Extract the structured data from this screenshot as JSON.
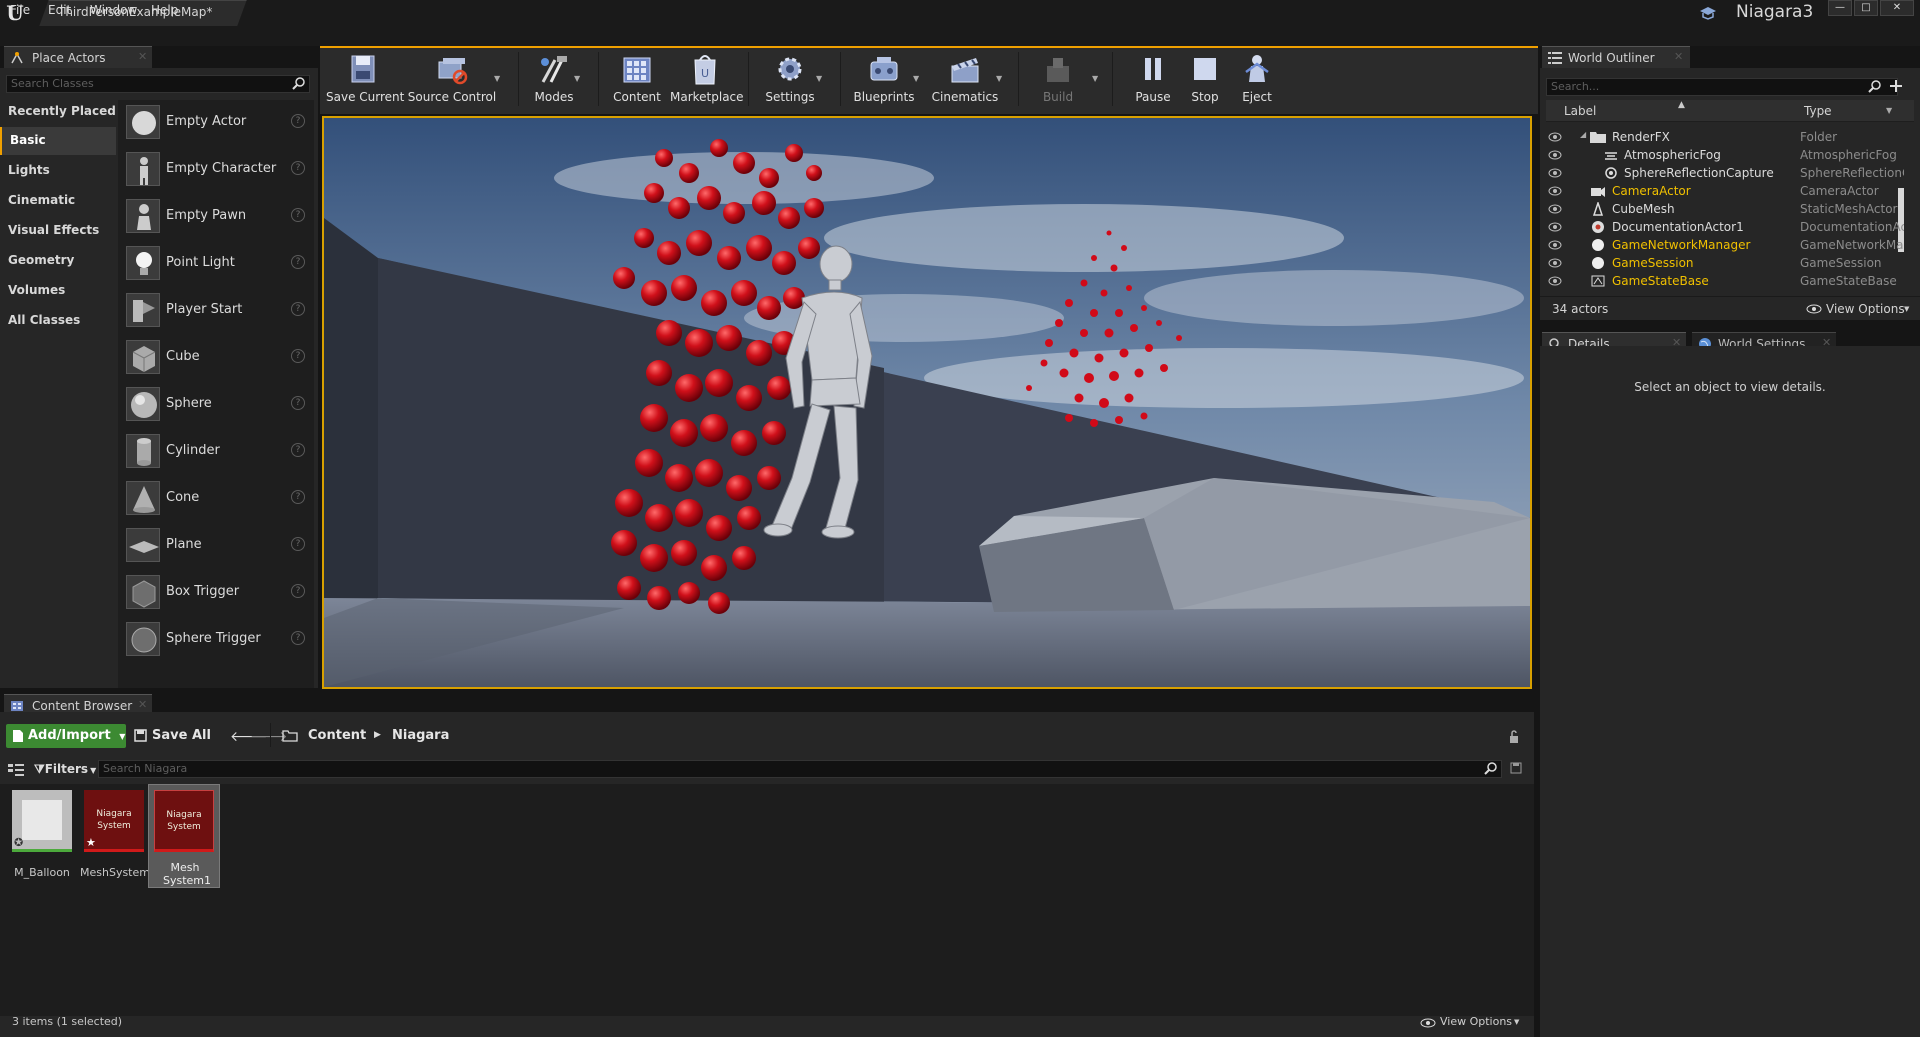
{
  "window": {
    "doc_tab": "ThirdPersonExampleMap*",
    "project_name": "Niagara3",
    "buttons": {
      "minimize": "—",
      "maximize": "□",
      "close": "✕"
    }
  },
  "menu": [
    "File",
    "Edit",
    "Window",
    "Help"
  ],
  "place_actors": {
    "tab": "Place Actors",
    "search_placeholder": "Search Classes",
    "categories": [
      "Recently Placed",
      "Basic",
      "Lights",
      "Cinematic",
      "Visual Effects",
      "Geometry",
      "Volumes",
      "All Classes"
    ],
    "selected_category": "Basic",
    "items": [
      "Empty Actor",
      "Empty Character",
      "Empty Pawn",
      "Point Light",
      "Player Start",
      "Cube",
      "Sphere",
      "Cylinder",
      "Cone",
      "Plane",
      "Box Trigger",
      "Sphere Trigger"
    ],
    "help_glyph": "?"
  },
  "toolbar": {
    "save_current": "Save Current",
    "source_control": "Source Control",
    "modes": "Modes",
    "content": "Content",
    "marketplace": "Marketplace",
    "settings": "Settings",
    "blueprints": "Blueprints",
    "cinematics": "Cinematics",
    "build": "Build",
    "pause": "Pause",
    "stop": "Stop",
    "eject": "Eject"
  },
  "world_outliner": {
    "tab": "World Outliner",
    "search_placeholder": "Search...",
    "col_label": "Label",
    "col_type": "Type",
    "rows": [
      {
        "label": "RenderFX",
        "type": "Folder",
        "indent": 0,
        "highlight": false
      },
      {
        "label": "AtmosphericFog",
        "type": "AtmosphericFog",
        "indent": 1,
        "highlight": false
      },
      {
        "label": "SphereReflectionCapture",
        "type": "SphereReflectionC",
        "indent": 1,
        "highlight": false
      },
      {
        "label": "CameraActor",
        "type": "CameraActor",
        "indent": 0,
        "highlight": true
      },
      {
        "label": "CubeMesh",
        "type": "StaticMeshActor",
        "indent": 0,
        "highlight": false
      },
      {
        "label": "DocumentationActor1",
        "type": "DocumentationAc",
        "indent": 0,
        "highlight": false
      },
      {
        "label": "GameNetworkManager",
        "type": "GameNetworkMar",
        "indent": 0,
        "highlight": true
      },
      {
        "label": "GameSession",
        "type": "GameSession",
        "indent": 0,
        "highlight": true
      },
      {
        "label": "GameStateBase",
        "type": "GameStateBase",
        "indent": 0,
        "highlight": true
      }
    ],
    "actor_count": "34 actors",
    "view_options": "View Options"
  },
  "details": {
    "tab_details": "Details",
    "tab_world_settings": "World Settings",
    "empty_message": "Select an object to view details."
  },
  "content_browser": {
    "tab": "Content Browser",
    "add_import": "Add/Import",
    "save_all": "Save All",
    "path": [
      "Content",
      "Niagara"
    ],
    "filters": "Filters",
    "search_placeholder": "Search Niagara",
    "assets": [
      {
        "name": "M_Balloon",
        "thumb_text": "",
        "selected": false
      },
      {
        "name": "MeshSystem",
        "thumb_text": "Niagara System",
        "selected": false
      },
      {
        "name": "Mesh System1",
        "thumb_text": "Niagara System",
        "selected": true
      }
    ],
    "item_count": "3 items (1 selected)",
    "view_options": "View Options"
  },
  "colors": {
    "accent": "#f0a000",
    "add_import_green": "#3c8a32",
    "niagara_red": "#6e1010",
    "outliner_highlight": "#f0c000"
  }
}
